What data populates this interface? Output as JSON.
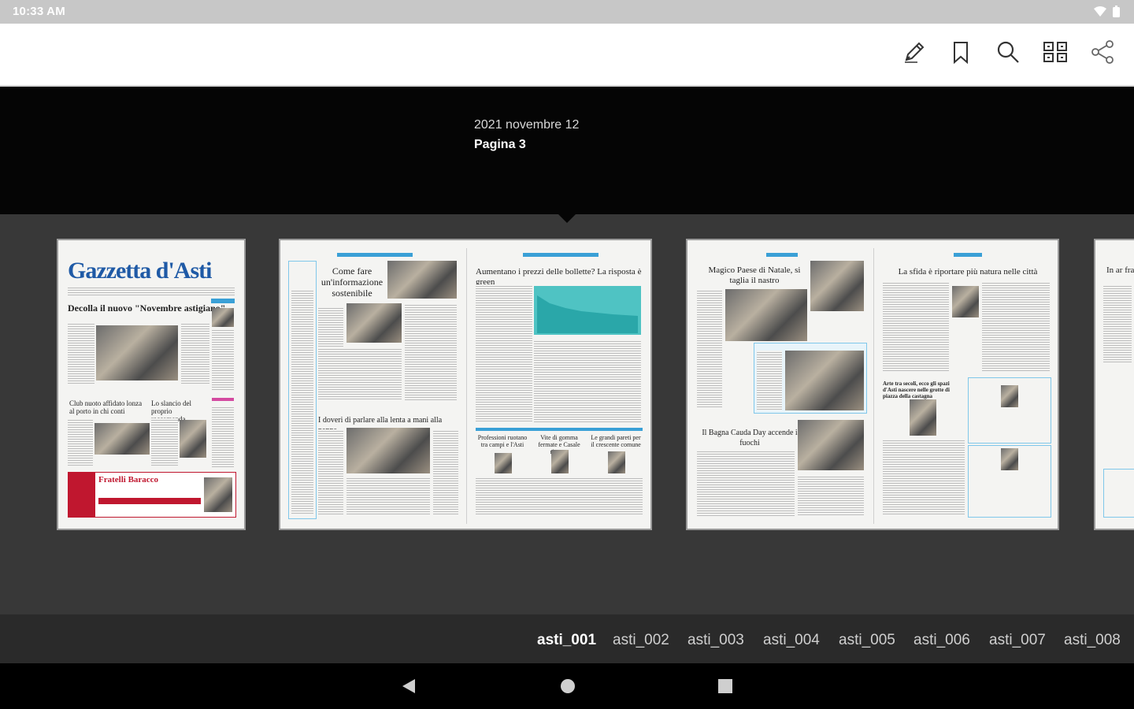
{
  "status_bar": {
    "time": "10:33 AM"
  },
  "toolbar": {
    "buttons": [
      {
        "icon": "pen-icon"
      },
      {
        "icon": "bookmark-icon"
      },
      {
        "icon": "search-icon"
      },
      {
        "icon": "grid-view-icon"
      },
      {
        "icon": "share-icon"
      }
    ]
  },
  "issue": {
    "date": "2021 novembre 12",
    "page": "Pagina 3"
  },
  "thumbnails": {
    "page1": {
      "masthead": "Gazzetta d'Asti",
      "headline": "Decolla il nuovo \"Novembre astigiano\"",
      "sub_left": "Club nuoto affidato lonza al porto in chi conti",
      "sub_right": "Lo slancio del proprio raccomanda Cantine",
      "ad_title": "Fratelli Baracco"
    },
    "page2_3": {
      "headline_left": "Come fare un'informazione sostenibile",
      "headline_left_bottom": "I doveri di parlare alla lenta a mani alla panna",
      "headline_right": "Aumentano i prezzi delle bollette? La risposta è green",
      "sub_right_1": "Professioni ruotano tra campi e l'Asti",
      "sub_right_2": "Vite di gomma fermate e Casale rinasce",
      "sub_right_3": "Le grandi pareti per il crescente comune"
    },
    "page4_5": {
      "headline_left": "Magico Paese di Natale, si taglia il nastro",
      "headline_left_bottom": "Il Bagna Cauda Day accende i fuochi",
      "headline_right": "La sfida è riportare più natura nelle città",
      "sub_right": "Arte tra secoli, ecco gli spazi d'Asti nascere nelle grotte di piazza della castagna"
    },
    "page6": {
      "headline": "In ar fra"
    }
  },
  "tabs": [
    "asti_001",
    "asti_002",
    "asti_003",
    "asti_004",
    "asti_005",
    "asti_006",
    "asti_007",
    "asti_008"
  ],
  "active_tab": "asti_001",
  "nav": {
    "back": "back-icon",
    "home": "home-icon",
    "recents": "recents-icon"
  },
  "colors": {
    "masthead_blue": "#1f5aa6",
    "accent_blue": "#3aa0d6",
    "ad_red": "#c0172f"
  }
}
